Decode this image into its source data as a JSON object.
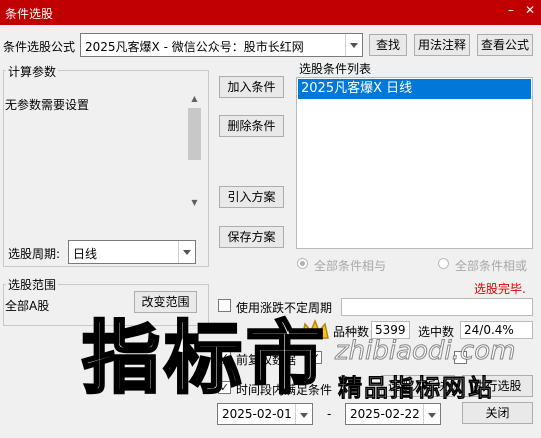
{
  "window": {
    "title": "条件选股",
    "min_symbol": "–",
    "close_symbol": "✕"
  },
  "top": {
    "formula_label": "条件选股公式",
    "formula_value": "2025凡客爆X  -  微信公众号：股市长红网",
    "find_button": "查找",
    "usage_button": "用法注释",
    "view_button": "查看公式"
  },
  "params": {
    "group_title": "计算参数",
    "message": "无参数需要设置",
    "period_label": "选股周期:",
    "period_value": "日线"
  },
  "actions": {
    "add": "加入条件",
    "delete": "删除条件",
    "import": "引入方案",
    "save": "保存方案"
  },
  "conditions": {
    "title": "选股条件列表",
    "items": [
      "2025凡客爆X  日线"
    ],
    "mode_and": "全部条件相与",
    "mode_or": "全部条件相或",
    "status": "选股完毕."
  },
  "range": {
    "group_title": "选股范围",
    "value": "全部A股",
    "change_button": "改变范围"
  },
  "options": {
    "irregular_period_label": "使用涨跌不定周期",
    "front_adjust_label": "前复权数据",
    "time_label": "时间段内满足条件",
    "start_date": "2025-02-01",
    "date_separator": "-",
    "end_date": "2025-02-22"
  },
  "stats": {
    "total_label": "品种数",
    "total_value": "5399",
    "selected_label": "选中数",
    "selected_value": "24/0.4%"
  },
  "bottom_buttons": {
    "to_board": "选股入板块",
    "run": "执行选股",
    "close": "关闭"
  },
  "watermark": {
    "big": "指标市",
    "url": "zhibiaodi.com",
    "sub": "精品指标网站"
  },
  "colors": {
    "titlebar": "#c00000",
    "selection": "#0078d7",
    "status_red": "#e00000"
  }
}
